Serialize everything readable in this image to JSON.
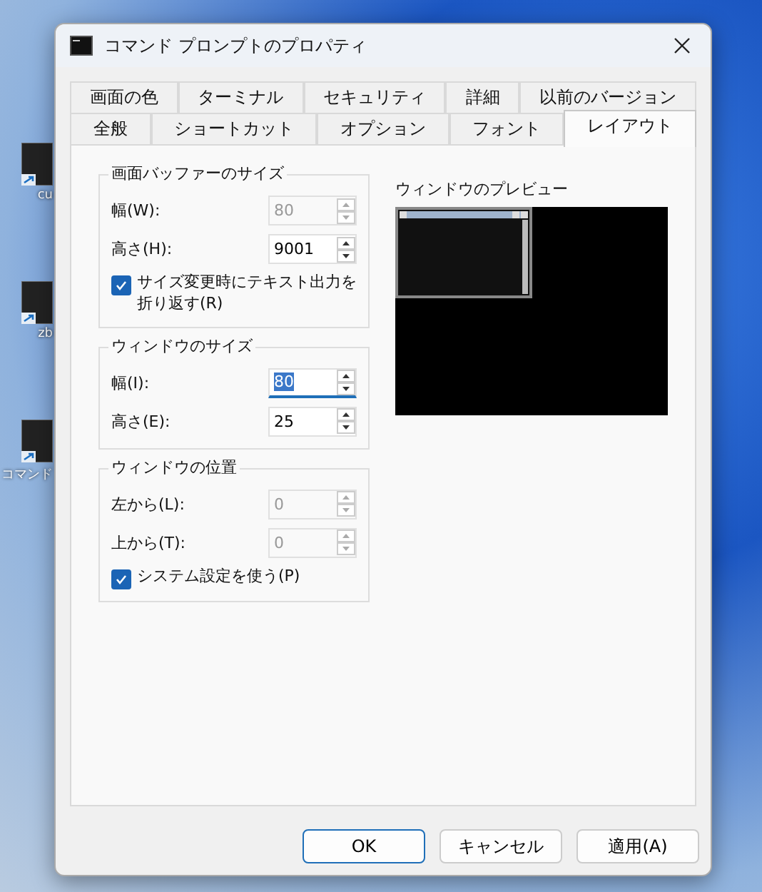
{
  "desktop_icons": [
    {
      "label": "cu"
    },
    {
      "label": "zb"
    },
    {
      "label": "コマンド"
    }
  ],
  "window": {
    "title": "コマンド プロンプトのプロパティ"
  },
  "tabs": [
    [
      {
        "label": "画面の色",
        "selected": false
      },
      {
        "label": "ターミナル",
        "selected": false
      },
      {
        "label": "セキュリティ",
        "selected": false
      },
      {
        "label": "詳細",
        "selected": false
      },
      {
        "label": "以前のバージョン",
        "selected": false
      }
    ],
    [
      {
        "label": "全般",
        "selected": false
      },
      {
        "label": "ショートカット",
        "selected": false
      },
      {
        "label": "オプション",
        "selected": false
      },
      {
        "label": "フォント",
        "selected": false
      },
      {
        "label": "レイアウト",
        "selected": true
      }
    ]
  ],
  "buffer_size": {
    "title": "画面バッファーのサイズ",
    "fields": [
      {
        "label": "幅(W):",
        "value": "80",
        "disabled": true,
        "focused": false
      },
      {
        "label": "高さ(H):",
        "value": "9001",
        "disabled": false,
        "focused": false
      }
    ],
    "wrap": {
      "label": "サイズ変更時にテキスト出力を折り返す(R)",
      "checked": true
    }
  },
  "window_size": {
    "title": "ウィンドウのサイズ",
    "fields": [
      {
        "label": "幅(I):",
        "value": "80",
        "disabled": false,
        "focused": true
      },
      {
        "label": "高さ(E):",
        "value": "25",
        "disabled": false,
        "focused": false
      }
    ]
  },
  "window_position": {
    "title": "ウィンドウの位置",
    "fields": [
      {
        "label": "左から(L):",
        "value": "0",
        "disabled": true,
        "focused": false
      },
      {
        "label": "上から(T):",
        "value": "0",
        "disabled": true,
        "focused": false
      }
    ],
    "use_system": {
      "label": "システム設定を使う(P)",
      "checked": true
    }
  },
  "preview": {
    "title": "ウィンドウのプレビュー"
  },
  "buttons": [
    {
      "label": "OK",
      "default": true
    },
    {
      "label": "キャンセル",
      "default": false
    },
    {
      "label": "適用(A)",
      "default": false
    }
  ]
}
